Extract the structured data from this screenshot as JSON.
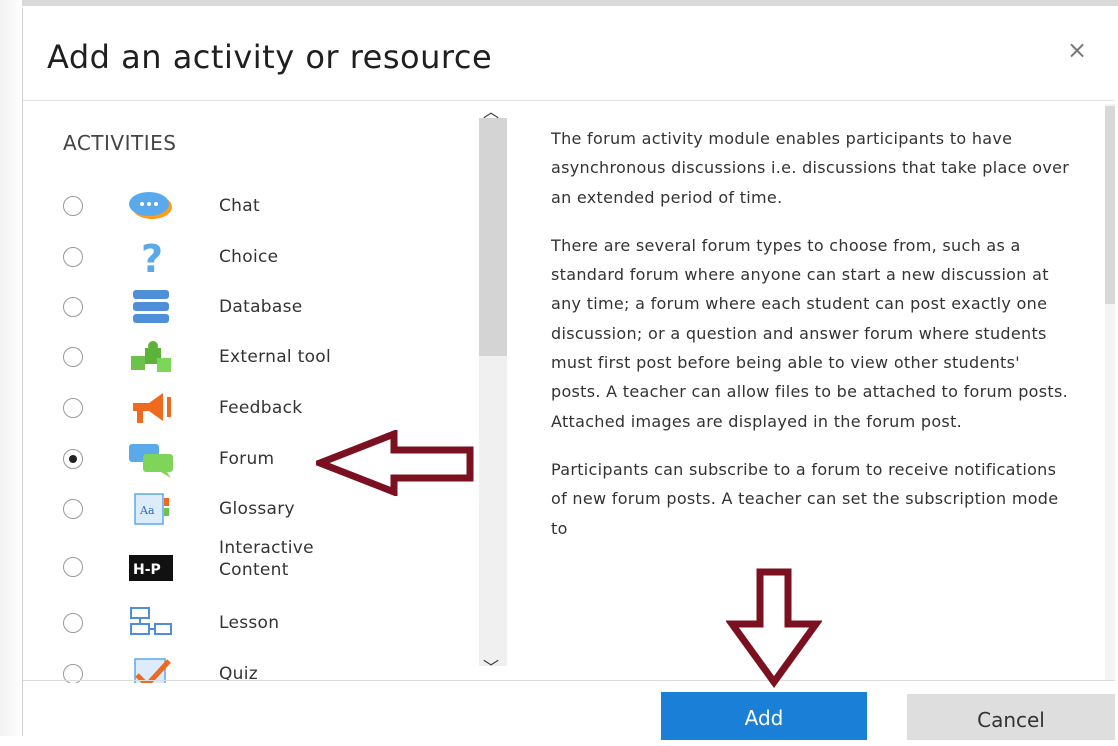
{
  "dialog": {
    "title": "Add an activity or resource",
    "close_label": "×"
  },
  "activities": {
    "section_title": "ACTIVITIES",
    "items": [
      {
        "label": "Chat",
        "icon": "chat-icon",
        "checked": false
      },
      {
        "label": "Choice",
        "icon": "question-icon",
        "checked": false
      },
      {
        "label": "Database",
        "icon": "database-icon",
        "checked": false
      },
      {
        "label": "External tool",
        "icon": "puzzle-icon",
        "checked": false
      },
      {
        "label": "Feedback",
        "icon": "megaphone-icon",
        "checked": false
      },
      {
        "label": "Forum",
        "icon": "forum-icon",
        "checked": true
      },
      {
        "label": "Glossary",
        "icon": "glossary-icon",
        "checked": false
      },
      {
        "label": "Interactive Content",
        "label_line1": "Interactive",
        "label_line2": "Content",
        "icon": "h5p-icon",
        "checked": false
      },
      {
        "label": "Lesson",
        "icon": "lesson-icon",
        "checked": false
      },
      {
        "label": "Quiz",
        "icon": "quiz-icon",
        "checked": false
      }
    ]
  },
  "description": {
    "paragraphs": [
      "The forum activity module enables participants to have asynchronous discussions i.e. discussions that take place over an extended period of time.",
      "There are several forum types to choose from, such as a standard forum where anyone can start a new discussion at any time; a forum where each student can post exactly one discussion; or a question and answer forum where students must first post before being able to view other students' posts. A teacher can allow files to be attached to forum posts. Attached images are displayed in the forum post.",
      "Participants can subscribe to a forum to receive notifications of new forum posts. A teacher can set the subscription mode to"
    ]
  },
  "footer": {
    "add_label": "Add",
    "cancel_label": "Cancel"
  },
  "colors": {
    "primary": "#1a7fd6",
    "annotation_arrow": "#7a1020"
  }
}
